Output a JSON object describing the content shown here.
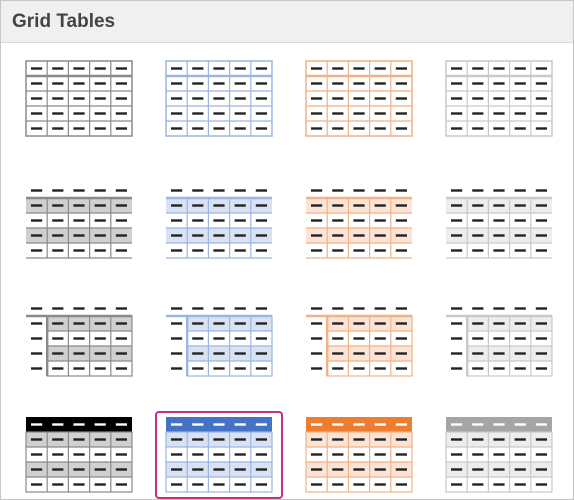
{
  "section": {
    "title": "Grid Tables"
  },
  "gallery": {
    "rows": 4,
    "columns": 4,
    "selected": {
      "row": 3,
      "col": 1
    },
    "column_colors": [
      {
        "name": "black",
        "accent": "#000000",
        "line": "#8a8a8a",
        "light": "#d0d0d0"
      },
      {
        "name": "blue",
        "accent": "#4472c4",
        "line": "#9db5e3",
        "light": "#d9e2f3"
      },
      {
        "name": "orange",
        "accent": "#ed7d31",
        "line": "#f4b183",
        "light": "#fbe4d5"
      },
      {
        "name": "gray",
        "accent": "#a5a5a5",
        "line": "#c9c9c9",
        "light": "#ededed"
      }
    ],
    "row_styles": [
      "grid-table-light",
      "grid-table-banded",
      "grid-table-first-column",
      "grid-table-header"
    ]
  }
}
